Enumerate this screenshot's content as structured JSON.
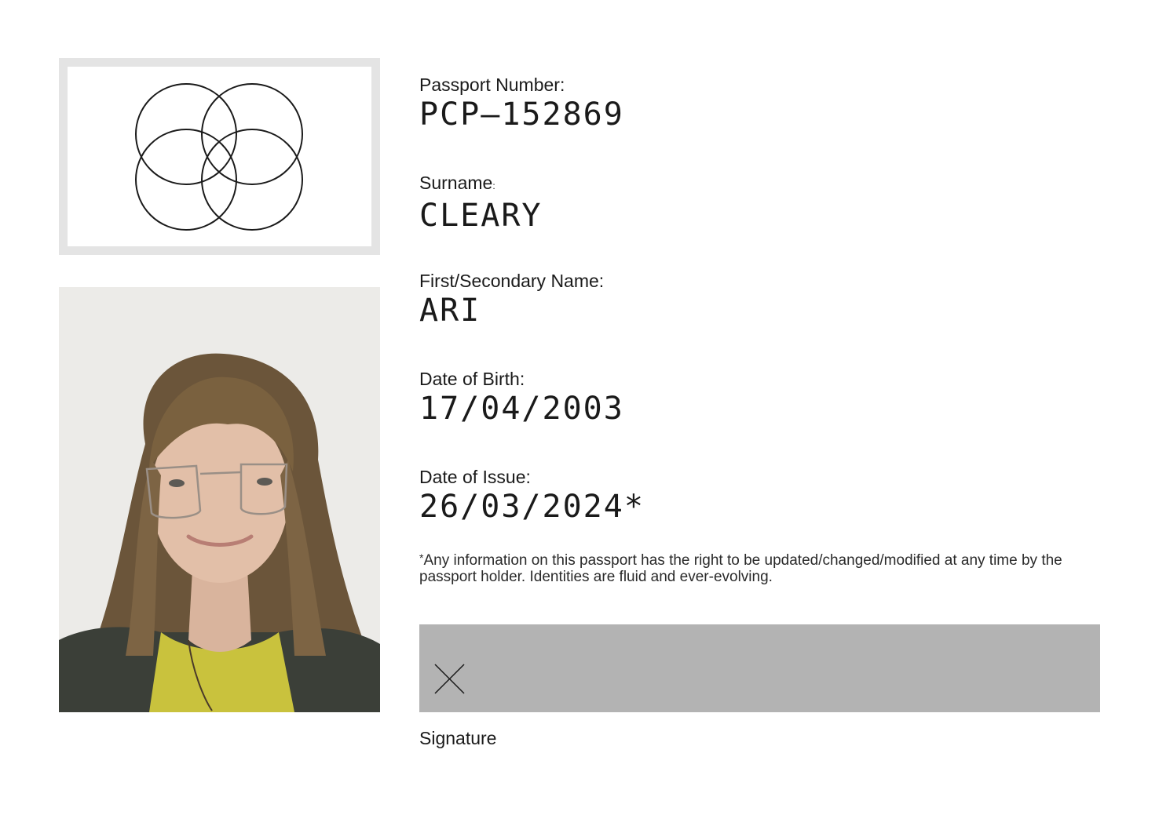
{
  "emblem": {
    "icon": "four-overlapping-circles-icon"
  },
  "photo": {
    "icon": "portrait-photo",
    "description_visible": false
  },
  "fields": {
    "passport_number": {
      "label": "Passport Number:",
      "value": "PCP–152869"
    },
    "surname": {
      "label": "Surname",
      "label_suffix": ":",
      "value": "CLEARY"
    },
    "first_name": {
      "label": "First/Secondary Name:",
      "value": "ARI"
    },
    "date_of_birth": {
      "label": "Date of Birth:",
      "value": "17/04/2003"
    },
    "date_of_issue": {
      "label": "Date of Issue:",
      "value": "26/03/2024*"
    }
  },
  "disclaimer": {
    "marker": "*",
    "text": "Any information on this passport has the right to be updated/changed/modified at any time by the passport holder. Identities are fluid and ever-evolving."
  },
  "signature": {
    "mark": "×",
    "label": "Signature",
    "box_color": "#b3b3b3"
  },
  "colors": {
    "frame": "#e4e4e4",
    "text": "#1a1a1a"
  }
}
